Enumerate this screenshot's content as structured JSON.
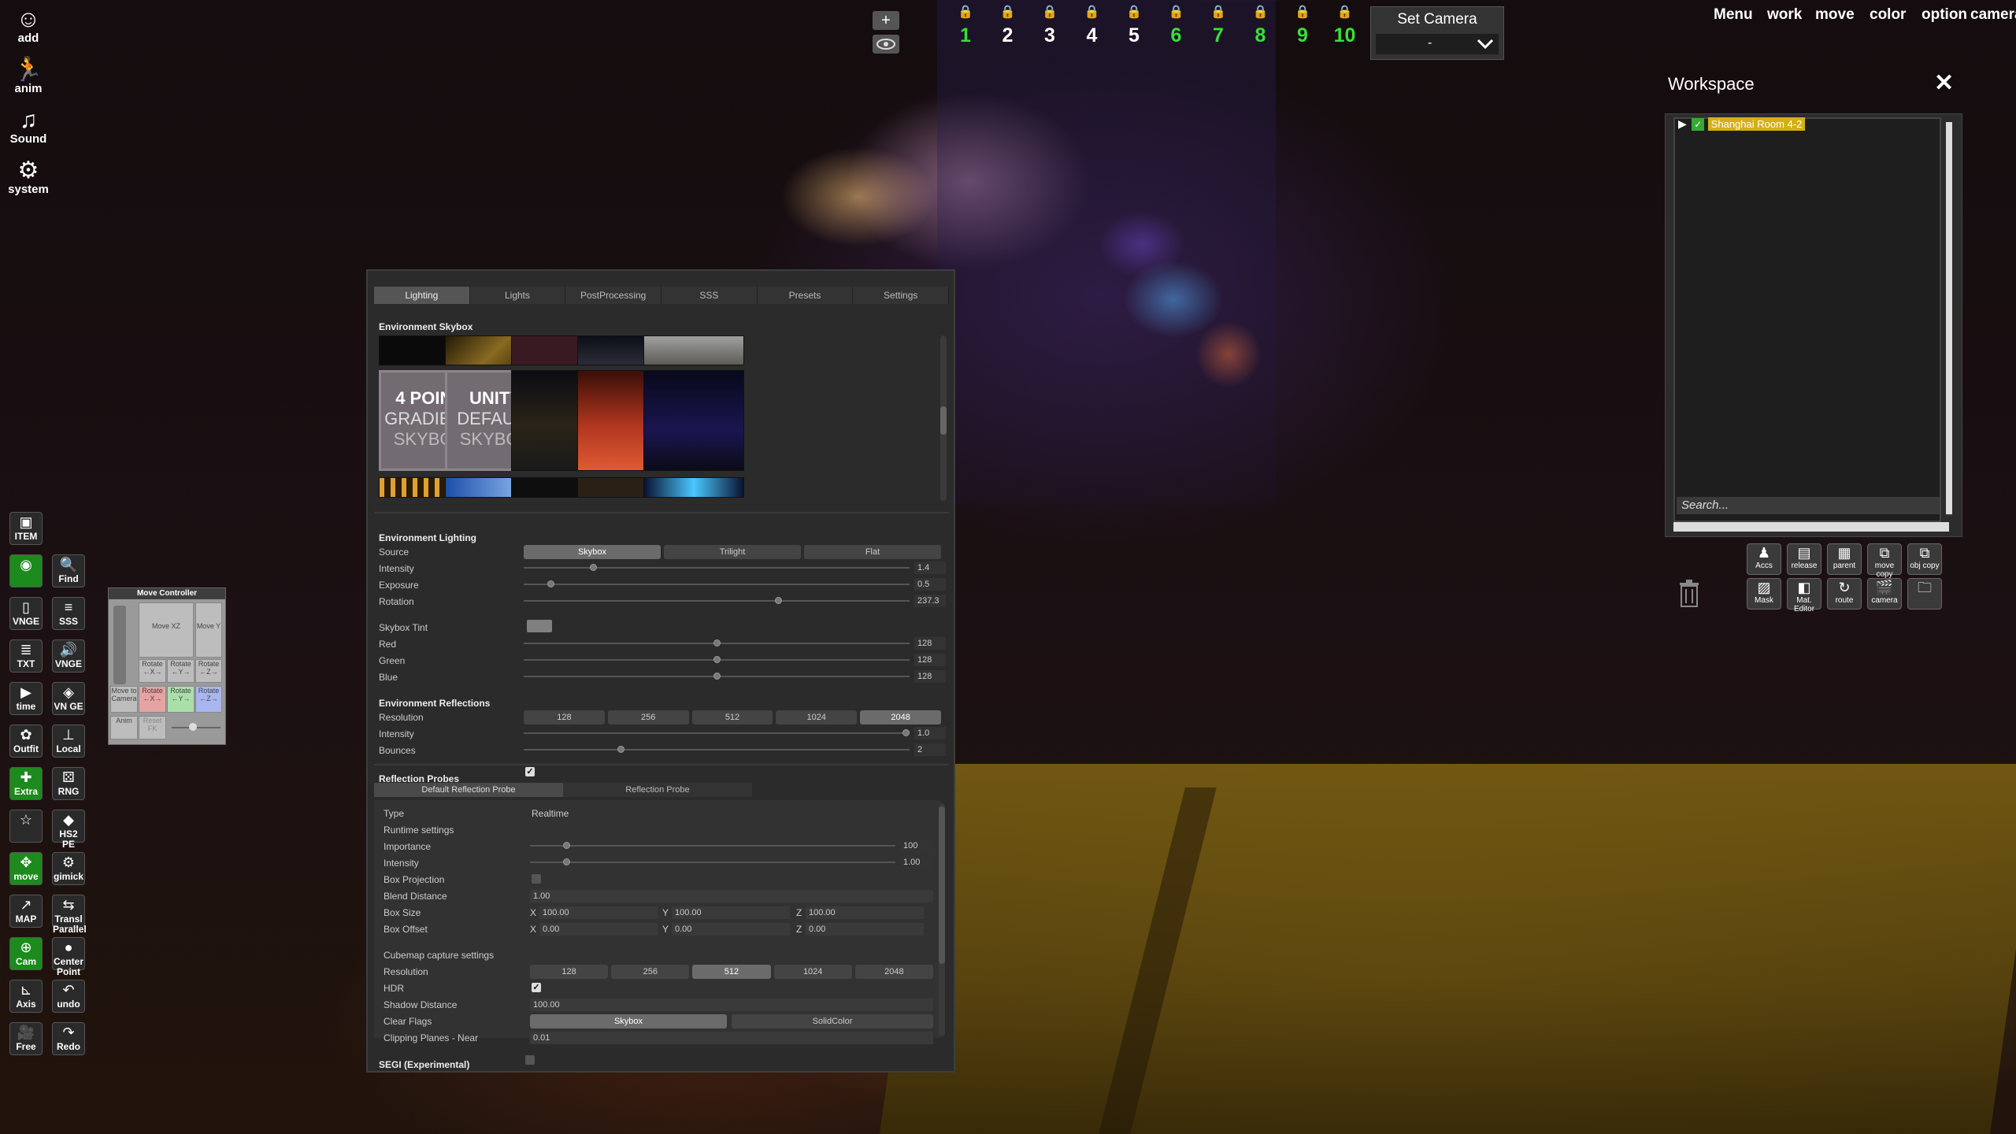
{
  "left_top": [
    {
      "icon": "person-add-icon",
      "label": "add"
    },
    {
      "icon": "running-figure-icon",
      "label": "anim"
    },
    {
      "icon": "music-note-icon",
      "label": "Sound"
    },
    {
      "icon": "gear-icon",
      "label": "system"
    }
  ],
  "left_tools": [
    {
      "label": "ITEM",
      "icon": "item-icon",
      "col": 0,
      "row": 0,
      "green": false
    },
    {
      "label": "",
      "icon": "camera-circle-icon",
      "col": 0,
      "row": 1,
      "green": true
    },
    {
      "label": "Find",
      "icon": "magnifier-icon",
      "col": 1,
      "row": 1,
      "green": false
    },
    {
      "label": "VNGE",
      "icon": "book-icon",
      "col": 0,
      "row": 2,
      "green": false
    },
    {
      "label": "SSS",
      "icon": "sss-icon",
      "col": 1,
      "row": 2,
      "green": false
    },
    {
      "label": "TXT",
      "icon": "txt-icon",
      "col": 0,
      "row": 3,
      "green": false
    },
    {
      "label": "VNGE",
      "icon": "speaker-icon",
      "col": 1,
      "row": 3,
      "green": false
    },
    {
      "label": "time",
      "icon": "play-pause-icon",
      "col": 0,
      "row": 4,
      "green": false
    },
    {
      "label": "VN GE",
      "icon": "vnge-icon",
      "col": 1,
      "row": 4,
      "green": false
    },
    {
      "label": "Outfit",
      "icon": "outfit-icon",
      "col": 0,
      "row": 5,
      "green": false
    },
    {
      "label": "Local",
      "icon": "axis-local-icon",
      "col": 1,
      "row": 5,
      "green": false
    },
    {
      "label": "Extra",
      "icon": "extra-icon",
      "col": 0,
      "row": 6,
      "green": true
    },
    {
      "label": "RNG",
      "icon": "dice-icon",
      "col": 1,
      "row": 6,
      "green": false
    },
    {
      "label": "",
      "icon": "star-icon",
      "col": 0,
      "row": 7,
      "green": false
    },
    {
      "label": "HS2 PE",
      "icon": "hs2pe-icon",
      "col": 1,
      "row": 7,
      "green": false
    },
    {
      "label": "move",
      "icon": "move-arrows-icon",
      "col": 0,
      "row": 8,
      "green": true
    },
    {
      "label": "gimick",
      "icon": "gimmick-gear-icon",
      "col": 1,
      "row": 8,
      "green": false
    },
    {
      "label": "MAP",
      "icon": "map-icon",
      "col": 0,
      "row": 9,
      "green": false
    },
    {
      "label": "Transl Parallel",
      "icon": "translate-icon",
      "col": 1,
      "row": 9,
      "green": false
    },
    {
      "label": "Cam",
      "icon": "add-camera-icon",
      "col": 0,
      "row": 10,
      "green": true
    },
    {
      "label": "Center Point",
      "icon": "center-point-icon",
      "col": 1,
      "row": 10,
      "green": false
    },
    {
      "label": "Axis",
      "icon": "axis-icon",
      "col": 0,
      "row": 11,
      "green": false
    },
    {
      "label": "undo",
      "icon": "undo-icon",
      "col": 1,
      "row": 11,
      "green": false
    },
    {
      "label": "Free",
      "icon": "film-camera-icon",
      "col": 0,
      "row": 12,
      "green": false
    },
    {
      "label": "Redo",
      "icon": "redo-icon",
      "col": 1,
      "row": 12,
      "green": false
    }
  ],
  "move_controller": {
    "title": "Move Controller",
    "move_xz": "Move XZ",
    "move_y": "Move Y",
    "rotate_x": "Rotate ←X→",
    "rotate_y": "Rotate ←Y→",
    "rotate_z": "Rotate ←Z→",
    "move_to_camera": "Move to Camera",
    "anim": "Anim",
    "reset_fk": "Reset FK"
  },
  "camera_slots": [
    {
      "num": "1",
      "color": "#37e037"
    },
    {
      "num": "2",
      "color": "#ffffff"
    },
    {
      "num": "3",
      "color": "#ffffff"
    },
    {
      "num": "4",
      "color": "#ffffff"
    },
    {
      "num": "5",
      "color": "#ffffff"
    },
    {
      "num": "6",
      "color": "#37e037"
    },
    {
      "num": "7",
      "color": "#37e037"
    },
    {
      "num": "8",
      "color": "#37e037"
    },
    {
      "num": "9",
      "color": "#37e037"
    },
    {
      "num": "10",
      "color": "#37e037"
    }
  ],
  "set_camera": {
    "label": "Set Camera",
    "value": "-"
  },
  "top_menu": [
    "Menu",
    "work",
    "move",
    "color",
    "option",
    "camera"
  ],
  "lighting": {
    "tabs": [
      "Lighting",
      "Lights",
      "PostProcessing",
      "SSS",
      "Presets",
      "Settings"
    ],
    "env_skybox": {
      "title": "Environment Skybox",
      "tile_4point": [
        "4 POINT",
        "GRADIENT",
        "SKYBOX"
      ],
      "tile_unity": [
        "UNITY",
        "DEFAULT",
        "SKYBOX"
      ]
    },
    "env_lighting": {
      "title": "Environment Lighting",
      "source_label": "Source",
      "source_options": [
        "Skybox",
        "Trilight",
        "Flat"
      ],
      "source_selected": 0,
      "intensity_label": "Intensity",
      "intensity": "1.4",
      "intensity_frac": 0.18,
      "exposure_label": "Exposure",
      "exposure": "0.5",
      "exposure_frac": 0.07,
      "rotation_label": "Rotation",
      "rotation": "237.3",
      "rotation_frac": 0.66,
      "tint_label": "Skybox Tint",
      "red_label": "Red",
      "red": "128",
      "red_frac": 0.5,
      "green_label": "Green",
      "green": "128",
      "green_frac": 0.5,
      "blue_label": "Blue",
      "blue": "128",
      "blue_frac": 0.5
    },
    "env_reflections": {
      "title": "Environment Reflections",
      "resolution_label": "Resolution",
      "resolutions": [
        "128",
        "256",
        "512",
        "1024",
        "2048"
      ],
      "resolution_selected": 4,
      "intensity_label": "Intensity",
      "intensity": "1.0",
      "intensity_frac": 0.99,
      "bounces_label": "Bounces",
      "bounces": "2",
      "bounces_frac": 0.25
    },
    "reflection_probes": {
      "title": "Reflection Probes",
      "tab_default": "Default Reflection Probe",
      "tab_probe": "Reflection Probe",
      "type_label": "Type",
      "type": "Realtime",
      "runtime_label": "Runtime settings",
      "importance_label": "Importance",
      "importance": "100",
      "importance_frac": 0.1,
      "intensity_label": "Intensity",
      "intensity": "1.00",
      "intensity_frac": 0.1,
      "box_projection_label": "Box Projection",
      "blend_label": "Blend Distance",
      "blend": "1.00",
      "box_size_label": "Box Size",
      "box_size_x": "100.00",
      "box_size_y": "100.00",
      "box_size_z": "100.00",
      "box_offset_label": "Box Offset",
      "box_offset_x": "0.00",
      "box_offset_y": "0.00",
      "box_offset_z": "0.00",
      "axis_x": "X",
      "axis_y": "Y",
      "axis_z": "Z",
      "cubemap_label": "Cubemap capture settings",
      "resolution_label": "Resolution",
      "resolutions": [
        "128",
        "256",
        "512",
        "1024",
        "2048"
      ],
      "resolution_selected": 2,
      "hdr_label": "HDR",
      "shadow_label": "Shadow Distance",
      "shadow": "100.00",
      "clear_label": "Clear Flags",
      "clear_options": [
        "Skybox",
        "SolidColor"
      ],
      "clip_label": "Clipping Planes - Near",
      "clip": "0.01"
    },
    "segi_label": "SEGI (Experimental)"
  },
  "workspace": {
    "title": "Workspace",
    "item": "Shanghai Room 4-2",
    "search_placeholder": "Search...",
    "buttons_row1": [
      {
        "label": "Accs",
        "icon": "person-accs-icon"
      },
      {
        "label": "release",
        "icon": "release-icon"
      },
      {
        "label": "parent",
        "icon": "parent-grid-icon"
      },
      {
        "label": "move copy",
        "icon": "move-copy-icon"
      },
      {
        "label": "obj copy",
        "icon": "obj-copy-icon"
      }
    ],
    "buttons_row2": [
      {
        "label": "Mask",
        "icon": "mask-icon"
      },
      {
        "label": "Mat. Editor",
        "icon": "mat-editor-icon"
      },
      {
        "label": "route",
        "icon": "route-icon"
      },
      {
        "label": "camera",
        "icon": "clapper-camera-icon"
      },
      {
        "label": "",
        "icon": "folder-icon"
      }
    ]
  }
}
